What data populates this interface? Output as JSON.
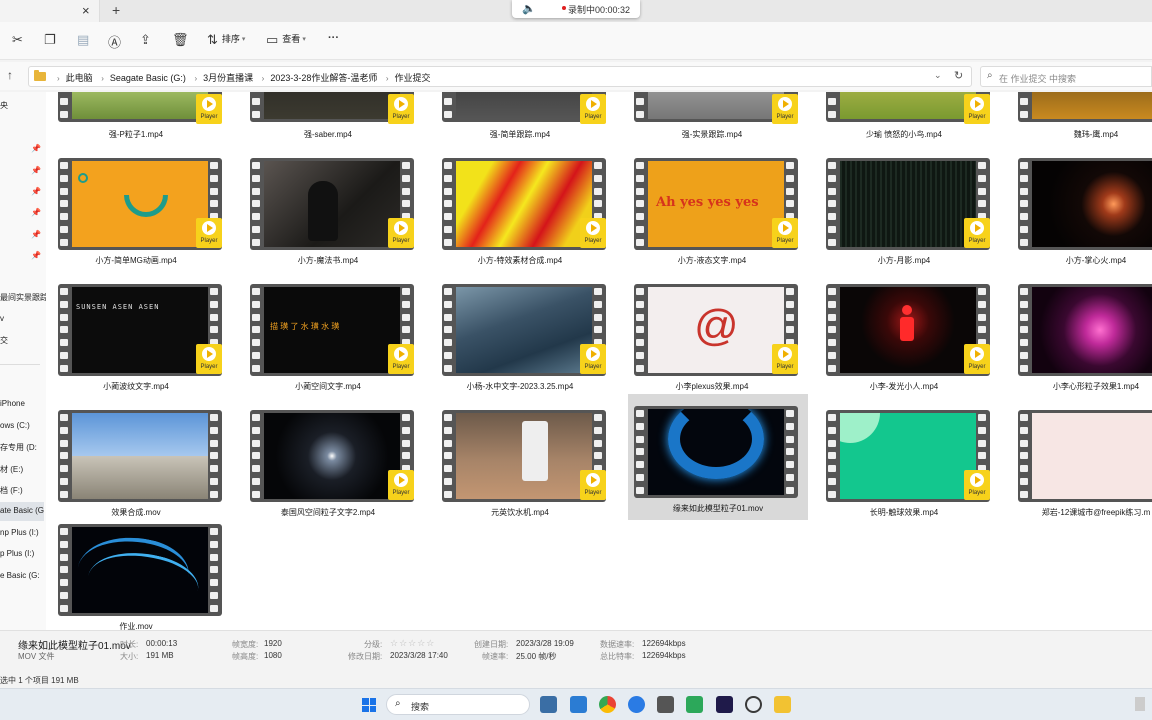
{
  "tabbar": {
    "close": "×",
    "add": "+"
  },
  "recording": {
    "text": "录制中00:00:32"
  },
  "toolbar": {
    "sort_label": "排序",
    "view_label": "查看",
    "more_label": "···"
  },
  "address": {
    "crumbs": [
      "此电脑",
      "Seagate Basic (G:)",
      "3月份直播课",
      "2023-3-28作业解答-温老师",
      "作业提交"
    ],
    "search_placeholder": "在 作业提交 中搜索"
  },
  "sidebar": {
    "items": [
      "央",
      "最间实景跟踪",
      "v",
      "交",
      "iPhone",
      "ows (C:)",
      "存专用 (D:",
      "材 (E:)",
      "档 (F:)",
      "ate Basic (G",
      "np Plus (I:)",
      "p Plus (I:)",
      "e Basic (G:"
    ]
  },
  "files": {
    "row0": [
      {
        "name": "强-P粒子1.mp4",
        "badge": "Player"
      },
      {
        "name": "强-saber.mp4",
        "badge": "Player"
      },
      {
        "name": "强-简单跟踪.mp4",
        "badge": "Player"
      },
      {
        "name": "强-实景跟踪.mp4",
        "badge": "Player"
      },
      {
        "name": "少瑜 愤怒的小鸟.mp4",
        "badge": "Player"
      },
      {
        "name": "魏玮-鹰.mp4",
        "badge": ""
      }
    ],
    "row1": [
      {
        "name": "小方-简单MG动画.mp4",
        "badge": "Player"
      },
      {
        "name": "小方-魔法书.mp4",
        "badge": "Player"
      },
      {
        "name": "小方-特效素材合成.mp4",
        "badge": "Player"
      },
      {
        "name": "小方-液态文字.mp4",
        "badge": "Player",
        "overlay": "Ah yes yes yes"
      },
      {
        "name": "小方-月影.mp4",
        "badge": "Player"
      },
      {
        "name": "小方-掌心火.mp4",
        "badge": ""
      }
    ],
    "row2": [
      {
        "name": "小蔺波纹文字.mp4",
        "badge": "Player",
        "overlay": "SUNSEN ASEN ASEN"
      },
      {
        "name": "小蔺空间文字.mp4",
        "badge": "Player",
        "overlay": "描 璜 了 水 璜 水 璜"
      },
      {
        "name": "小杨-水中文字-2023.3.25.mp4",
        "badge": "Player"
      },
      {
        "name": "小李plexus效果.mp4",
        "badge": "Player",
        "overlay": "@"
      },
      {
        "name": "小李-发光小人.mp4",
        "badge": "Player"
      },
      {
        "name": "小李心形粒子效果1.mp4",
        "badge": ""
      }
    ],
    "row3": [
      {
        "name": "效果合成.mov",
        "badge": ""
      },
      {
        "name": "泰国风空间粒子文字2.mp4",
        "badge": "Player"
      },
      {
        "name": "元英饮水机.mp4",
        "badge": "Player"
      },
      {
        "name": "缘来如此模型粒子01.mov",
        "badge": ""
      },
      {
        "name": "长明-触球效果.mp4",
        "badge": "Player"
      },
      {
        "name": "郑岩-12课城市@freepik练习.m",
        "badge": ""
      }
    ],
    "row4": [
      {
        "name": "作业.mov",
        "badge": ""
      }
    ]
  },
  "details": {
    "file_name": "缘来如此模型粒子01.mov",
    "file_type": "MOV 文件",
    "duration_label": "时长:",
    "duration": "00:00:13",
    "size_label": "大小:",
    "size": "191 MB",
    "width_label": "帧宽度:",
    "width": "1920",
    "height_label": "帧高度:",
    "height": "1080",
    "rating_label": "分级:",
    "rating": "☆☆☆☆☆",
    "modified_label": "修改日期:",
    "modified": "2023/3/28 17:40",
    "created_label": "创建日期:",
    "created": "2023/3/28 19:09",
    "framerate_label": "帧速率:",
    "framerate": "25.00 帧/秒",
    "datarate_label": "数据速率:",
    "datarate": "122694kbps",
    "bitrate_label": "总比特率:",
    "bitrate": "122694kbps"
  },
  "status": {
    "text": "选中 1 个项目  191 MB"
  },
  "taskbar": {
    "search": "搜索"
  },
  "colors": {
    "badge": "#f7d21b",
    "accent": "#1a73e8",
    "selected": "#d9d9d9"
  }
}
